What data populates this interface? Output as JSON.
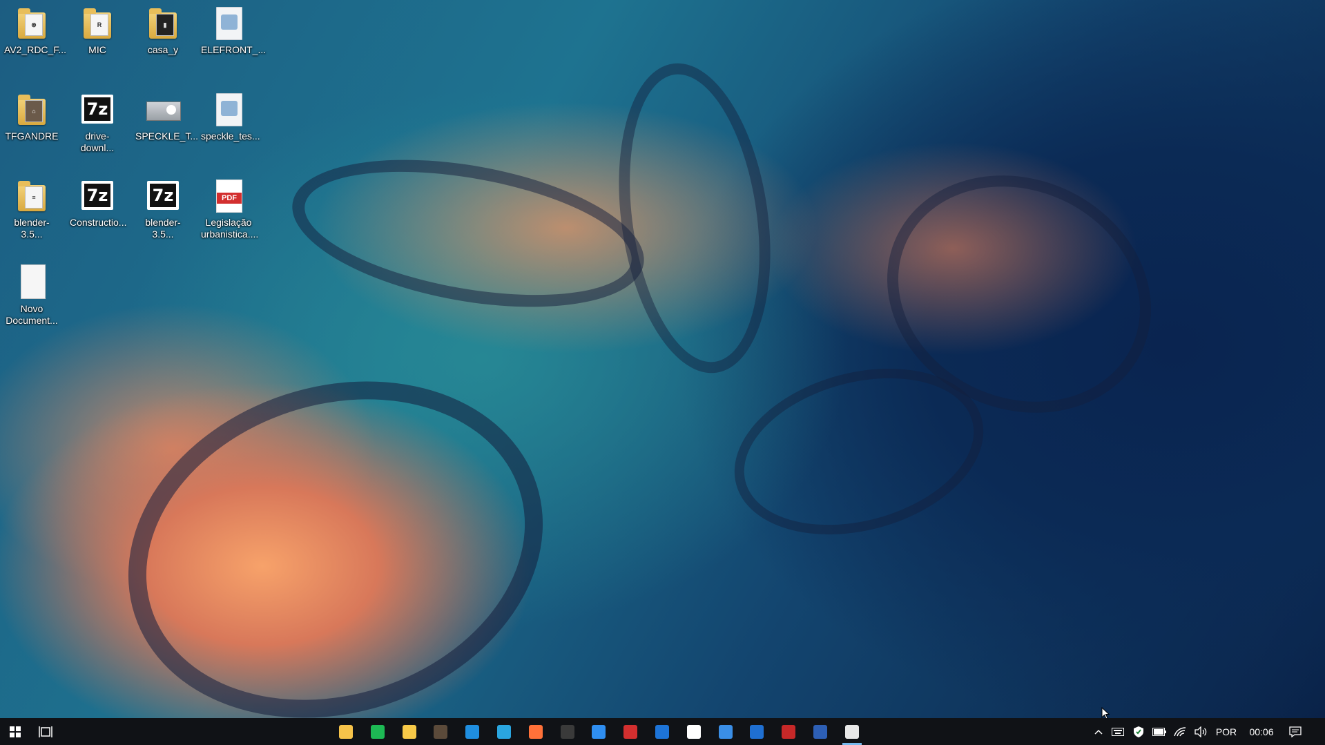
{
  "desktop": {
    "icons": [
      {
        "label": "AV2_RDC_F...",
        "icon": "folder-document-icon",
        "col": 0,
        "row": 0
      },
      {
        "label": "MIC",
        "icon": "folder-revit-icon",
        "col": 1,
        "row": 0
      },
      {
        "label": "casa_y",
        "icon": "folder-icon",
        "col": 2,
        "row": 0
      },
      {
        "label": "ELEFRONT_...",
        "icon": "grasshopper-file-icon",
        "col": 3,
        "row": 0
      },
      {
        "label": "TFGANDRE",
        "icon": "folder-image-icon",
        "col": 0,
        "row": 1
      },
      {
        "label": "drive-downl...",
        "icon": "7zip-archive-icon",
        "col": 1,
        "row": 1
      },
      {
        "label": "SPECKLE_T...",
        "icon": "image-file-icon",
        "col": 2,
        "row": 1
      },
      {
        "label": "speckle_tes...",
        "icon": "grasshopper-file-icon",
        "col": 3,
        "row": 1
      },
      {
        "label": "blender-3.5...",
        "icon": "folder-document-icon",
        "col": 0,
        "row": 2
      },
      {
        "label": "Constructio...",
        "icon": "7zip-archive-icon",
        "col": 1,
        "row": 2
      },
      {
        "label": "blender-3.5...",
        "icon": "7zip-archive-icon",
        "col": 2,
        "row": 2
      },
      {
        "label": "Legislação urbanistica....",
        "icon": "pdf-file-icon",
        "col": 3,
        "row": 2
      },
      {
        "label": "Novo Document...",
        "icon": "text-document-icon",
        "col": 0,
        "row": 3
      }
    ]
  },
  "taskbar": {
    "apps": [
      {
        "name": "file-explorer",
        "color": "#f6c34a"
      },
      {
        "name": "spotify",
        "color": "#1db954"
      },
      {
        "name": "sticky-notes",
        "color": "#f7c948"
      },
      {
        "name": "rhino",
        "color": "#5b4a3a"
      },
      {
        "name": "edge",
        "color": "#1f8ee0"
      },
      {
        "name": "edge-beta",
        "color": "#2aa6e0"
      },
      {
        "name": "firefox",
        "color": "#ff7139"
      },
      {
        "name": "terminal",
        "color": "#3a3a3a"
      },
      {
        "name": "vscode",
        "color": "#2f8ef0"
      },
      {
        "name": "acrobat",
        "color": "#d32f2f"
      },
      {
        "name": "app-blue",
        "color": "#1d74d8"
      },
      {
        "name": "pen-app",
        "color": "#ffffff"
      },
      {
        "name": "paint",
        "color": "#3a8ee6"
      },
      {
        "name": "layers-app",
        "color": "#1f6fd1"
      },
      {
        "name": "red-cube-app",
        "color": "#c62828"
      },
      {
        "name": "revit",
        "color": "#2d5fb5"
      },
      {
        "name": "remote-desktop",
        "color": "#e8e8e8"
      }
    ],
    "tray": {
      "language": "POR",
      "time": "00:06"
    }
  }
}
